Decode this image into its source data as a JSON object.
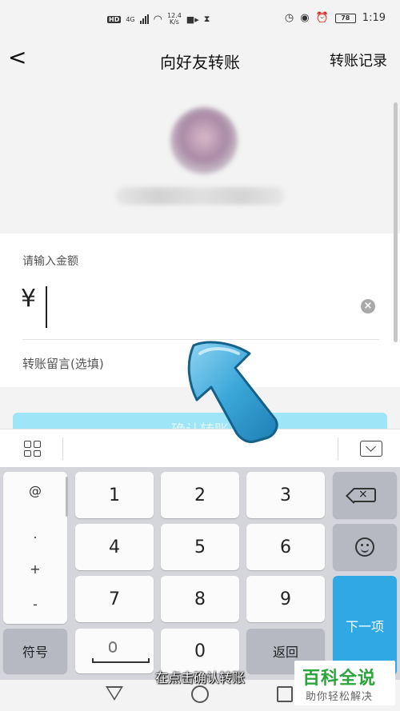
{
  "status_bar": {
    "hd": "HD",
    "network": "4G",
    "speed_value": "12.4",
    "speed_unit": "K/s",
    "battery": "78",
    "time": "1:19"
  },
  "header": {
    "back_glyph": "<",
    "title": "向好友转账",
    "records": "转账记录"
  },
  "amount": {
    "label": "请输入金额",
    "currency": "¥",
    "value": "",
    "clear_glyph": "×",
    "remark_placeholder": "转账留言(选填)"
  },
  "confirm_button": {
    "label": "确认转账"
  },
  "keyboard": {
    "symbols": [
      "@",
      ".",
      "+",
      "-"
    ],
    "digits": [
      "1",
      "2",
      "3",
      "4",
      "5",
      "6",
      "7",
      "8",
      "9",
      "0"
    ],
    "symbol_key": "符号",
    "return_key": "返回",
    "next_key": "下一项"
  },
  "caption": "在点击确认转账",
  "watermark": {
    "main": "百科全说",
    "sub": "助你轻松解决"
  },
  "colors": {
    "background_gray": "#f3f3f3",
    "confirm_button": "#9ee6f7",
    "next_key": "#2fa8e4",
    "arrow": "#3aa6d8",
    "watermark_green": "#2aa53b"
  }
}
